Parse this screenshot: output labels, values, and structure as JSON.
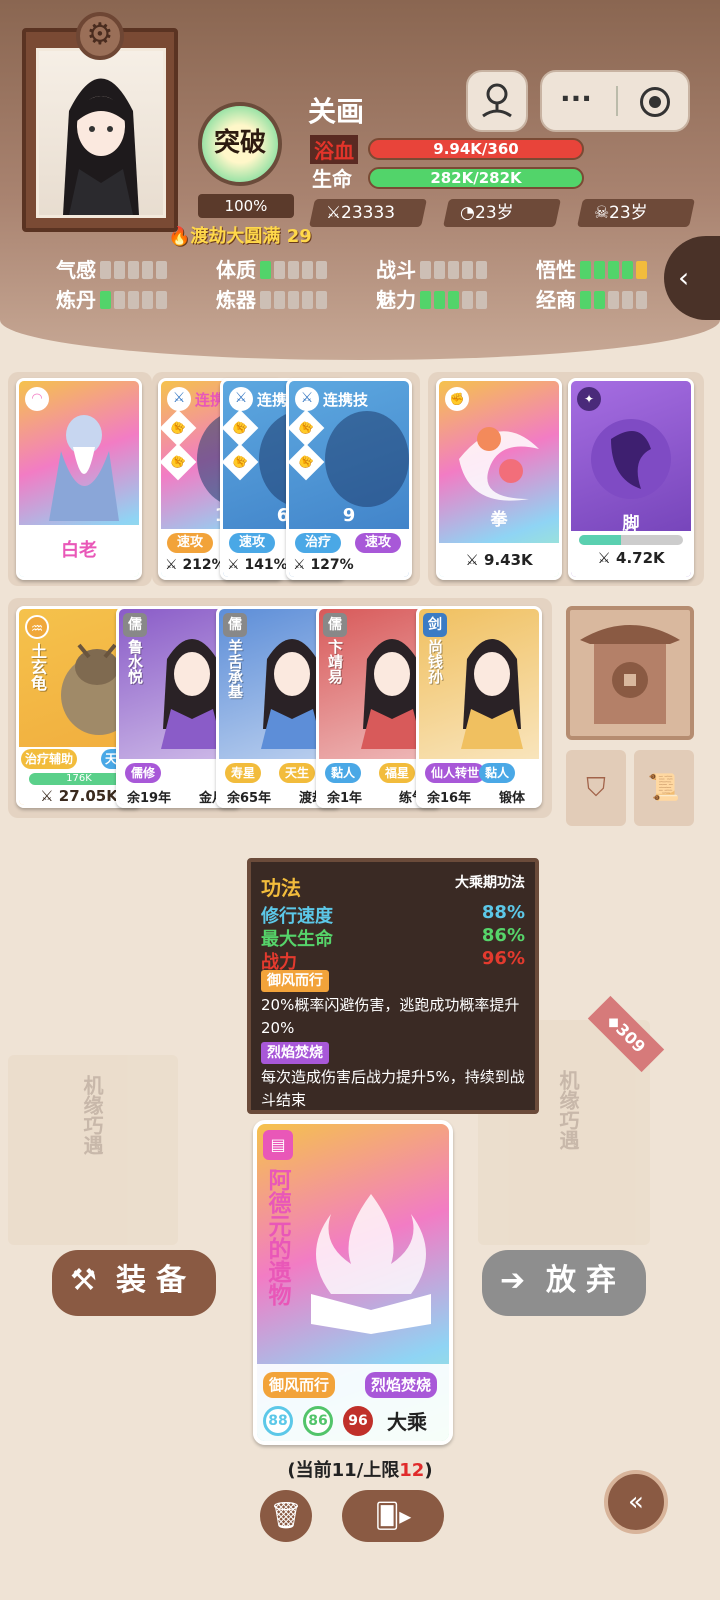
{
  "header": {
    "name": "关画",
    "breakthrough_label": "突破",
    "breakthrough_percent": "100%",
    "stats": {
      "blood_label": "浴血",
      "blood_value": "9.94K/360",
      "blood_fill": 1.0,
      "life_label": "生命",
      "life_value": "282K/282K",
      "life_fill": 1.0
    },
    "power": "23333",
    "age": "23岁",
    "lifespan": "23岁",
    "realm": "渡劫大圆满 29",
    "attributes": [
      {
        "label": "气感",
        "level": 0,
        "max": 5
      },
      {
        "label": "体质",
        "level": 1,
        "max": 5
      },
      {
        "label": "战斗",
        "level": 0,
        "max": 5
      },
      {
        "label": "悟性",
        "level": 5,
        "max": 5
      },
      {
        "label": "炼丹",
        "level": 1,
        "max": 5
      },
      {
        "label": "炼器",
        "level": 0,
        "max": 5
      },
      {
        "label": "魅力",
        "level": 3,
        "max": 5
      },
      {
        "label": "经商",
        "level": 2,
        "max": 5
      }
    ],
    "icons": {
      "settings": "gear-icon",
      "map": "map-pin-icon",
      "more": "more-dots-icon",
      "close": "close-circle-icon",
      "collapse": "chevron-left-icon"
    }
  },
  "row1": {
    "bailao": {
      "name": "白老"
    },
    "combo": [
      {
        "title": "连携",
        "number": "1",
        "tags": [
          "速攻"
        ],
        "power": "212%"
      },
      {
        "title": "连携",
        "number": "6",
        "tags": [
          "速攻"
        ],
        "power": "141%"
      },
      {
        "title": "连携技",
        "number": "9",
        "tags": [
          "治疗",
          "速攻"
        ],
        "power": "127%"
      }
    ],
    "fist": {
      "name": "拳",
      "power": "9.43K"
    },
    "foot": {
      "name": "脚",
      "power": "4.72K",
      "bar_fill": 0.4
    }
  },
  "row2": {
    "pet": {
      "name": "土玄龟",
      "tags": [
        "治疗辅助",
        "天才"
      ],
      "hp": "176K",
      "power": "27.05K"
    },
    "characters": [
      {
        "badge": "儒",
        "name": "鲁水悦",
        "tags": [
          "儒修"
        ],
        "years": "余19年",
        "extra": "金月"
      },
      {
        "badge": "儒",
        "name": "羊舌承基",
        "tags": [
          "寿星",
          "天生"
        ],
        "years": "余65年",
        "extra": "渡劫"
      },
      {
        "badge": "儒",
        "name": "卞靖易",
        "tags": [
          "黏人",
          "福星"
        ],
        "years": "余1年",
        "extra": "练气"
      },
      {
        "badge": "剑",
        "name": "尚钱孙",
        "tags": [
          "仙人转世",
          "黏人"
        ],
        "years": "余16年",
        "extra": "锻体"
      }
    ]
  },
  "tooltip": {
    "title": "功法",
    "period": "大乘期功法",
    "rows": [
      {
        "label": "修行速度",
        "value": "88%",
        "color": "#5cc8e8"
      },
      {
        "label": "最大生命",
        "value": "86%",
        "color": "#56d46a"
      },
      {
        "label": "战力",
        "value": "96%",
        "color": "#e33a2e"
      }
    ],
    "skills": [
      {
        "name": "御风而行",
        "desc": "20%概率闪避伤害，逃跑成功概率提升20%"
      },
      {
        "name": "烈焰焚烧",
        "desc": "每次造成伤害后战力提升5%，持续到战斗结束"
      }
    ]
  },
  "bigcard": {
    "name": "阿德元的遗物",
    "skill1": "御风而行",
    "skill2": "烈焰焚烧",
    "stat1": "88",
    "stat2": "86",
    "stat3": "96",
    "rank": "大乘"
  },
  "bg": {
    "left_text": "机缘巧遇",
    "right_text": "机缘巧遇",
    "gem_count": "309"
  },
  "actions": {
    "equip": "装备",
    "discard": "放弃"
  },
  "capacity": {
    "prefix": "(当前11/上限",
    "limit": "12",
    "suffix": ")"
  },
  "colors": {
    "accent": "#8a6651",
    "blood": "#e8443a",
    "life": "#52d46a",
    "equip_btn": "#8a5a43",
    "discard_btn": "#8a8a8a"
  }
}
